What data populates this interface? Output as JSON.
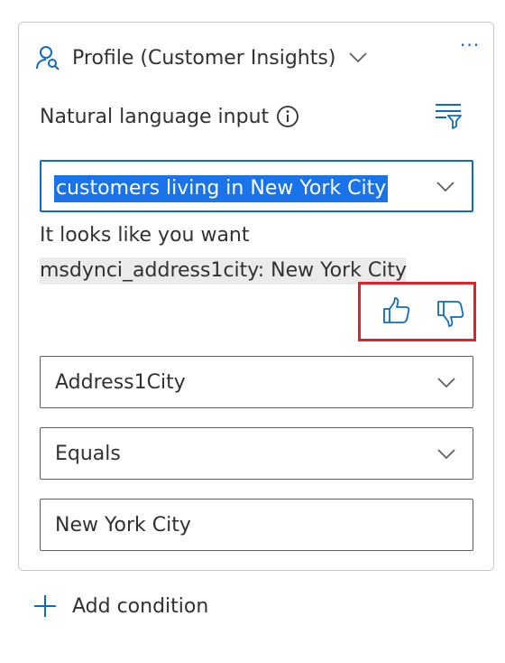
{
  "header": {
    "entity_label": "Profile (Customer Insights)",
    "more_label": "···"
  },
  "natural_language": {
    "label": "Natural language input",
    "input_value": "customers living in New York City"
  },
  "suggestion": {
    "line1": "It looks like you want",
    "line2": "msdynci_address1city: New York City"
  },
  "condition": {
    "attribute": "Address1City",
    "operator": "Equals",
    "value": "New York City"
  },
  "add_condition_label": "Add condition",
  "colors": {
    "accent": "#0f6cbd",
    "highlight": "#e0222b",
    "selection": "#1a73e8"
  },
  "icons": [
    "person-search-icon",
    "chevron-down-icon",
    "more-icon",
    "info-icon",
    "filter-icon",
    "thumbs-up-icon",
    "thumbs-down-icon",
    "add-icon"
  ]
}
